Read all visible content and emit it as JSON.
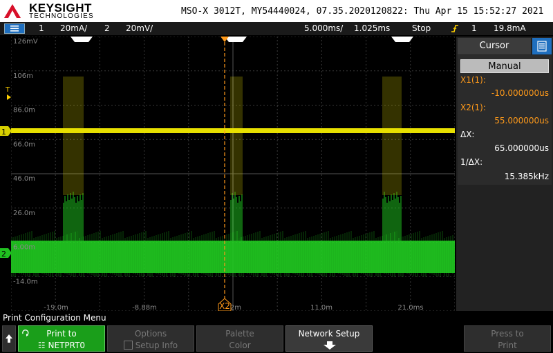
{
  "header": {
    "brand": "KEYSIGHT",
    "brand_sub": "TECHNOLOGIES",
    "title": "MSO-X 3012T, MY54440024, 07.35.2020120822: Thu Apr 15 15:52:27 2021"
  },
  "status": {
    "ch1_num": "1",
    "ch1_scale": "20mA/",
    "ch2_num": "2",
    "ch2_scale": "20mV/",
    "timebase": "5.000ms/",
    "delay": "1.025ms",
    "run_state": "Stop",
    "trigger_ch": "1",
    "trigger_level": "19.8mA"
  },
  "grid": {
    "y_labels": [
      "126mV",
      "106m",
      "86.0m",
      "66.0m",
      "46.0m",
      "26.0m",
      "6.00m",
      "-14.0m"
    ],
    "x_labels": [
      "-19.0m",
      "-8.88m",
      "1.02m",
      "11.0m",
      "21.0ms"
    ],
    "trigger_marker": "T",
    "ch1_marker": "1",
    "ch2_marker": "2",
    "cursor_label": "X2",
    "ch1_color": "#e8e000",
    "ch2_color": "#22d422",
    "cursor_color": "#ff9a1a"
  },
  "side": {
    "tab": "Cursor",
    "mode": "Manual",
    "x1_label": "X1(1):",
    "x1_value": "-10.000000us",
    "x2_label": "X2(1):",
    "x2_value": "55.000000us",
    "dx_label": "ΔX:",
    "dx_value": "65.000000us",
    "inv_label": "1/ΔX:",
    "inv_value": "15.385kHz"
  },
  "softkeys": {
    "menu_title": "Print Configuration Menu",
    "print_to_1": "Print to",
    "print_to_2": "NETPRT0",
    "options_1": "Options",
    "options_2": "Setup Info",
    "palette_1": "Palette",
    "palette_2": "Color",
    "network": "Network Setup",
    "press_1": "Press to",
    "press_2": "Print"
  }
}
